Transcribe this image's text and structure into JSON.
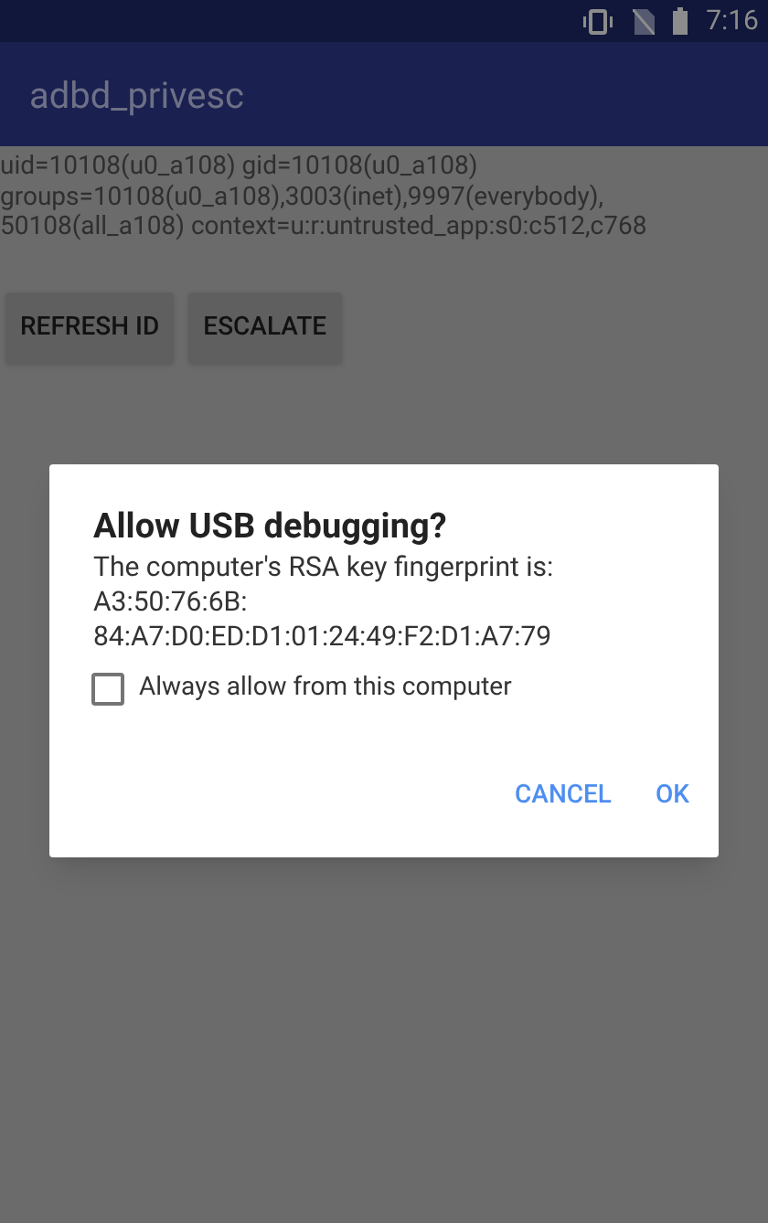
{
  "status_bar": {
    "time": "7:16"
  },
  "app_bar": {
    "title": "adbd_privesc"
  },
  "id_output": [
    "uid=10108(u0_a108) gid=10108(u0_a108)",
    "groups=10108(u0_a108),3003(inet),9997(everybody),",
    "50108(all_a108) context=u:r:untrusted_app:s0:c512,c768"
  ],
  "buttons": [
    "REFRESH ID",
    "ESCALATE"
  ],
  "dialog": {
    "title": "Allow USB debugging?",
    "message_lines": [
      "The computer's RSA key fingerprint is:",
      "A3:50:76:6B:",
      "84:A7:D0:ED:D1:01:24:49:F2:D1:A7:79"
    ],
    "checkbox": {
      "label": "Always allow from this computer",
      "checked": false
    },
    "actions": [
      "CANCEL",
      "OK"
    ]
  }
}
